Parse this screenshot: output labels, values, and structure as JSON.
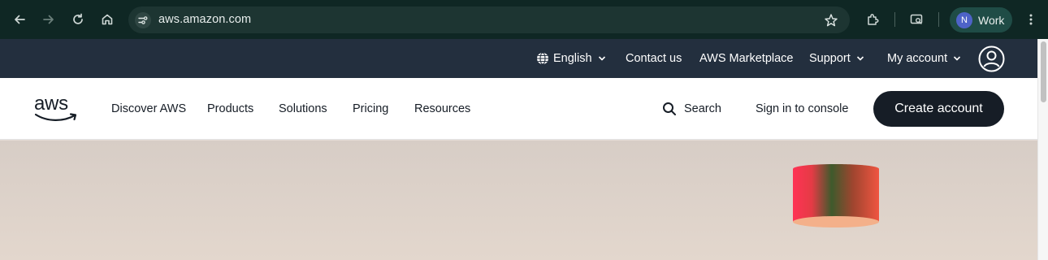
{
  "browser": {
    "url": "aws.amazon.com",
    "profile_initial": "N",
    "profile_label": "Work",
    "icons": [
      "back-arrow-icon",
      "forward-arrow-icon",
      "reload-icon",
      "home-icon",
      "site-settings-icon",
      "bookmark-star-icon",
      "extensions-icon",
      "side-panel-icon",
      "menu-kebab-icon"
    ]
  },
  "utilbar": {
    "language": "English",
    "contact": "Contact us",
    "marketplace": "AWS Marketplace",
    "support": "Support",
    "account": "My account"
  },
  "nav": {
    "logo": "aws",
    "items": [
      "Discover AWS",
      "Products",
      "Solutions",
      "Pricing",
      "Resources"
    ],
    "search": "Search",
    "signin": "Sign in to console",
    "create": "Create account"
  },
  "colors": {
    "chrome_bg": "#0f2724",
    "utilbar_bg": "#232f3e",
    "button_bg": "#161d26",
    "hero_bg": "#ddd2ca"
  }
}
